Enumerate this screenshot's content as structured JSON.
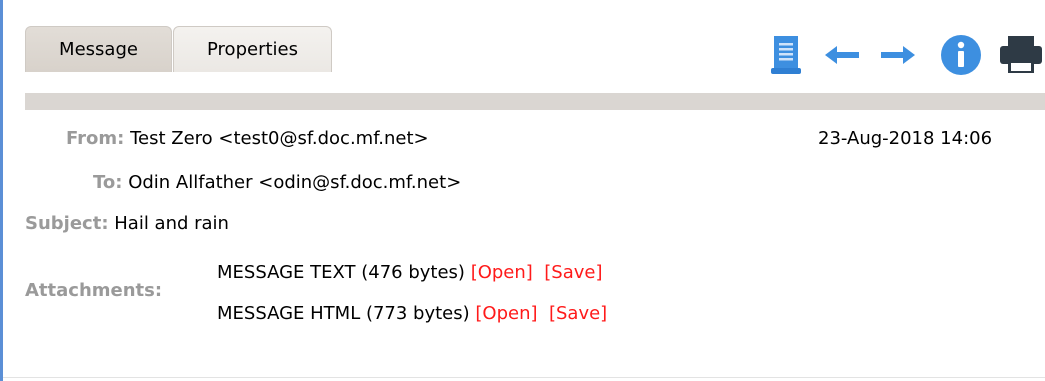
{
  "tabs": {
    "message": "Message",
    "properties": "Properties"
  },
  "toolbar": {
    "icons": [
      "document-icon",
      "arrow-left-icon",
      "arrow-right-icon",
      "info-icon",
      "printer-icon"
    ],
    "accent_color": "#3d8fe0"
  },
  "header": {
    "from_label": "From:",
    "from_value": "Test Zero <test0@sf.doc.mf.net>",
    "date": "23-Aug-2018 14:06",
    "to_label": "To:",
    "to_value": "Odin Allfather <odin@sf.doc.mf.net>",
    "subject_label": "Subject:",
    "subject_value": "Hail and rain",
    "attachments_label": "Attachments:",
    "attachments": [
      {
        "name": "MESSAGE TEXT (476 bytes)",
        "open": "[Open]",
        "save": "[Save]"
      },
      {
        "name": "MESSAGE HTML (773 bytes)",
        "open": "[Open]",
        "save": "[Save]"
      }
    ]
  },
  "colors": {
    "label_gray": "#9a9a9a",
    "link_red": "#ff1a1a",
    "tab_bar": "#dad6d2"
  }
}
